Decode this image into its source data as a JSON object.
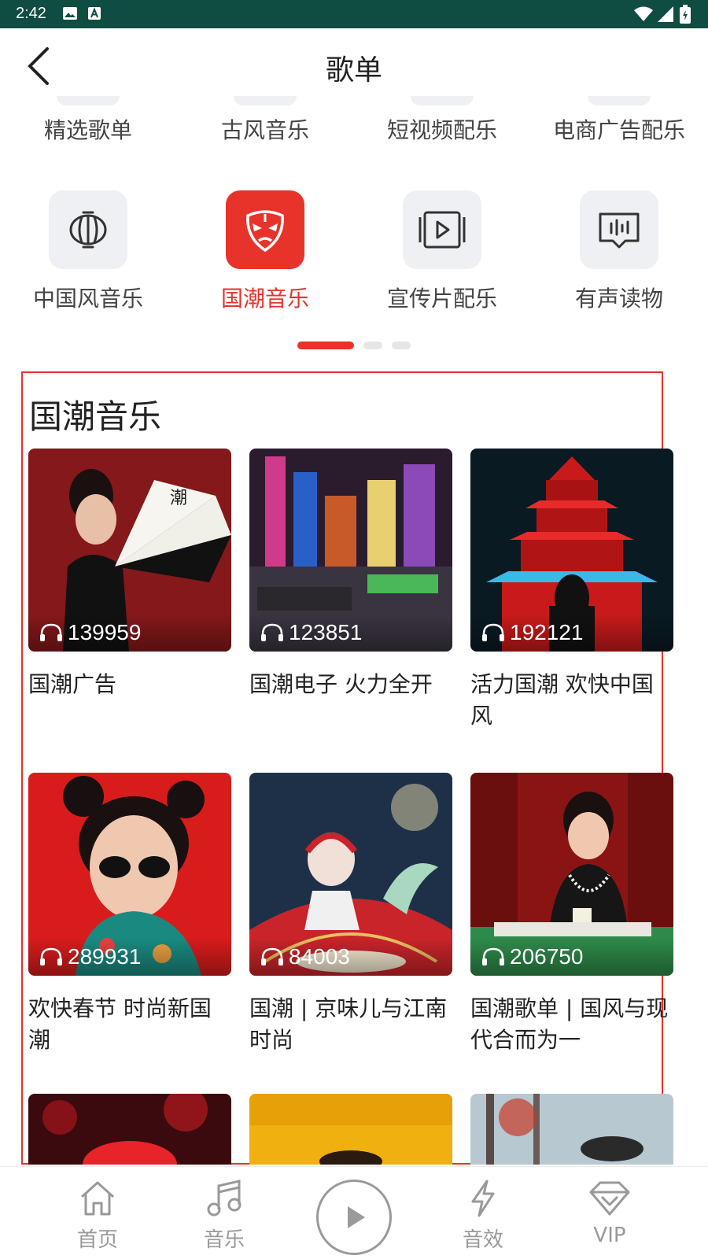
{
  "status_bar": {
    "time": "2:42"
  },
  "header": {
    "title": "歌单"
  },
  "categories_row1": [
    "精选歌单",
    "古风音乐",
    "短视频配乐",
    "电商广告配乐"
  ],
  "categories_row2": [
    {
      "label": "中国风音乐",
      "icon": "lantern-icon"
    },
    {
      "label": "国潮音乐",
      "icon": "opera-mask-icon",
      "active": true
    },
    {
      "label": "宣传片配乐",
      "icon": "video-play-icon"
    },
    {
      "label": "有声读物",
      "icon": "audio-wave-icon"
    }
  ],
  "pager": {
    "pages": 3,
    "current": 1
  },
  "section": {
    "title": "国潮音乐",
    "cards": [
      {
        "plays": "139959",
        "title": "国潮广告"
      },
      {
        "plays": "123851",
        "title": "国潮电子 火力全开"
      },
      {
        "plays": "192121",
        "title": "活力国潮 欢快中国风"
      },
      {
        "plays": "289931",
        "title": "欢快春节 时尚新国潮"
      },
      {
        "plays": "84003",
        "title": "国潮 | 京味儿与江南时尚"
      },
      {
        "plays": "206750",
        "title": "国潮歌单 | 国风与现代合而为一"
      }
    ]
  },
  "bottom_nav": {
    "home": "首页",
    "music": "音乐",
    "effects": "音效",
    "vip": "VIP"
  },
  "colors": {
    "accent": "#e8332b",
    "status_bar": "#0f4d42",
    "inactive": "#999999"
  }
}
